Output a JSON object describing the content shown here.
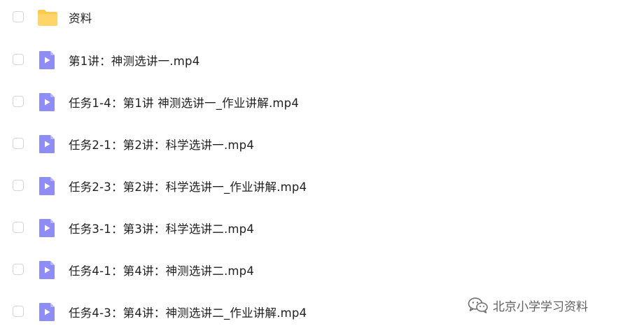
{
  "files": [
    {
      "type": "folder",
      "name": "资料",
      "icon": "folder-icon"
    },
    {
      "type": "video",
      "name": "第1讲：神测选讲一.mp4",
      "icon": "video-file-icon"
    },
    {
      "type": "video",
      "name": "任务1-4：第1讲 神测选讲一_作业讲解.mp4",
      "icon": "video-file-icon"
    },
    {
      "type": "video",
      "name": "任务2-1：第2讲：科学选讲一.mp4",
      "icon": "video-file-icon"
    },
    {
      "type": "video",
      "name": "任务2-3：第2讲：科学选讲一_作业讲解.mp4",
      "icon": "video-file-icon"
    },
    {
      "type": "video",
      "name": "任务3-1：第3讲：科学选讲二.mp4",
      "icon": "video-file-icon"
    },
    {
      "type": "video",
      "name": "任务4-1：第4讲：神测选讲二.mp4",
      "icon": "video-file-icon"
    },
    {
      "type": "video",
      "name": "任务4-3：第4讲：神测选讲二_作业讲解.mp4",
      "icon": "video-file-icon"
    }
  ],
  "watermark": {
    "text": "北京小学学习资料",
    "icon": "wechat-icon"
  },
  "colors": {
    "folder": "#ffc94a",
    "video_icon": "#8e8cf5",
    "checkbox_border": "#d6d6d6",
    "text": "#1f1f1f",
    "watermark": "#5f5f5f"
  }
}
